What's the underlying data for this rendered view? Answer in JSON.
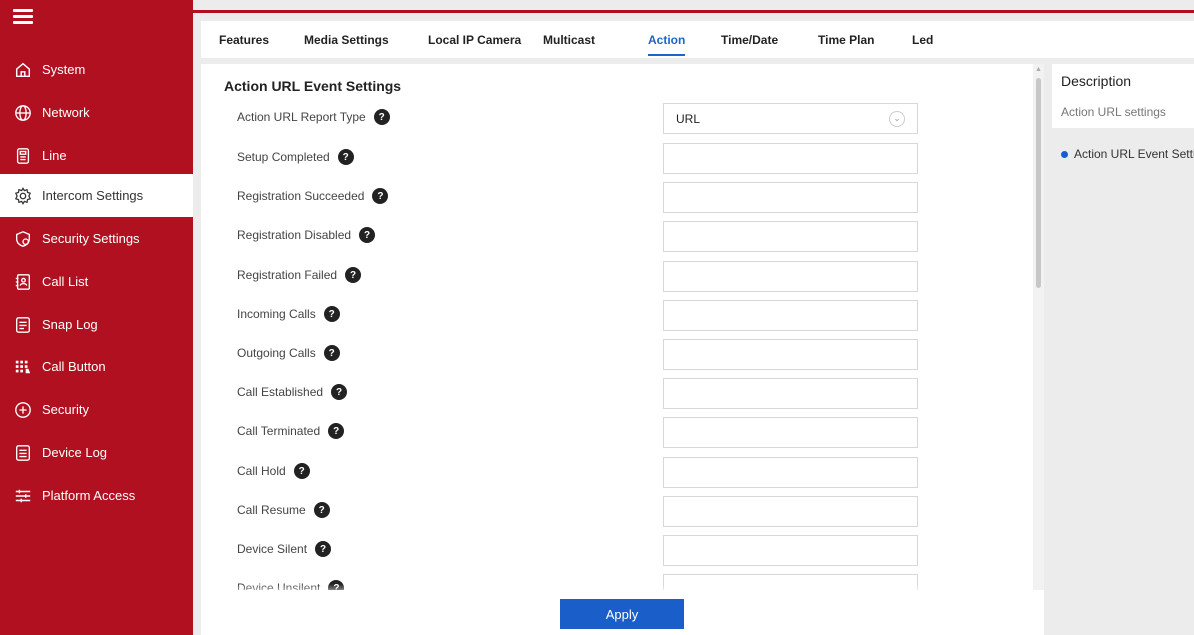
{
  "sidebar": {
    "items": [
      {
        "label": "System",
        "icon": "home-icon"
      },
      {
        "label": "Network",
        "icon": "globe-icon"
      },
      {
        "label": "Line",
        "icon": "phone-icon"
      },
      {
        "label": "Intercom Settings",
        "icon": "gear-icon",
        "active": true
      },
      {
        "label": "Security Settings",
        "icon": "shield-gear-icon"
      },
      {
        "label": "Call List",
        "icon": "contact-book-icon"
      },
      {
        "label": "Snap Log",
        "icon": "document-icon"
      },
      {
        "label": "Call Button",
        "icon": "keypad-icon"
      },
      {
        "label": "Security",
        "icon": "shield-plus-icon"
      },
      {
        "label": "Device Log",
        "icon": "log-icon"
      },
      {
        "label": "Platform Access",
        "icon": "sliders-icon"
      }
    ]
  },
  "tabs": [
    {
      "label": "Features"
    },
    {
      "label": "Media Settings"
    },
    {
      "label": "Local IP Camera"
    },
    {
      "label": "Multicast"
    },
    {
      "label": "Action",
      "active": true
    },
    {
      "label": "Time/Date"
    },
    {
      "label": "Time Plan"
    },
    {
      "label": "Led"
    }
  ],
  "main": {
    "section_title": "Action URL Event Settings",
    "help_glyph": "?",
    "report_type": {
      "label": "Action URL Report Type",
      "value": "URL"
    },
    "rows": [
      {
        "label": "Setup Completed",
        "value": ""
      },
      {
        "label": "Registration Succeeded",
        "value": ""
      },
      {
        "label": "Registration Disabled",
        "value": ""
      },
      {
        "label": "Registration Failed",
        "value": ""
      },
      {
        "label": "Incoming Calls",
        "value": ""
      },
      {
        "label": "Outgoing Calls",
        "value": ""
      },
      {
        "label": "Call Established",
        "value": ""
      },
      {
        "label": "Call Terminated",
        "value": ""
      },
      {
        "label": "Call Hold",
        "value": ""
      },
      {
        "label": "Call Resume",
        "value": ""
      },
      {
        "label": "Device Silent",
        "value": ""
      },
      {
        "label": "Device Unsilent",
        "value": ""
      }
    ],
    "apply_label": "Apply"
  },
  "description": {
    "title": "Description",
    "subtitle": "Action URL settings",
    "bullet": "Action URL Event Settings"
  },
  "colors": {
    "brand_red": "#b0101f",
    "accent_blue": "#1a5fc9"
  }
}
